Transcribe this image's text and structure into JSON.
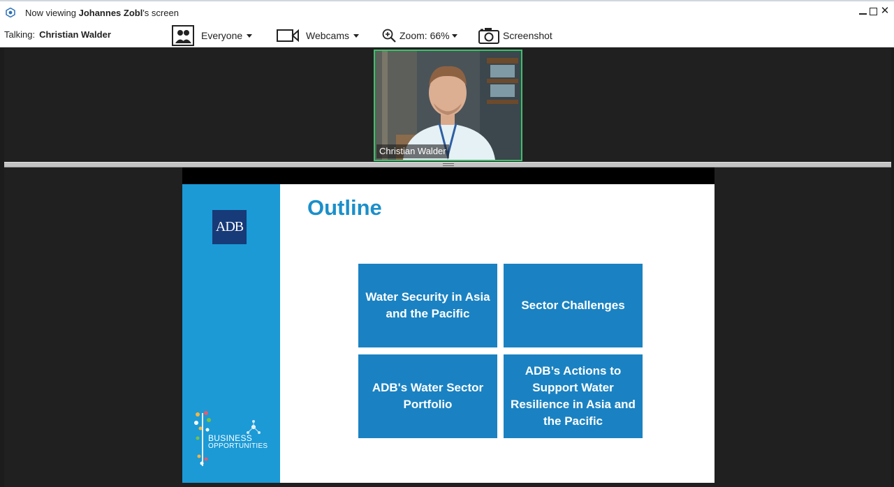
{
  "window": {
    "title_prefix": "Now viewing ",
    "presenter": "Johannes Zobl",
    "title_suffix": "'s screen"
  },
  "toolbar": {
    "talking_label": "Talking:",
    "talking_name": "Christian Walder",
    "audience_label": "Everyone",
    "webcams_label": "Webcams",
    "zoom_label": "Zoom: 66%",
    "screenshot_label": "Screenshot"
  },
  "webcam": {
    "participant_name": "Christian Walder",
    "border_color": "#3cc16a"
  },
  "slide": {
    "logo_text": "ADB",
    "title": "Outline",
    "brand_line1": "BUSINESS",
    "brand_line2": "OPPORTUNITIES",
    "boxes": [
      "Water Security in Asia and the Pacific",
      "Sector Challenges",
      "ADB's Water Sector Portfolio",
      "ADB’s Actions to Support Water Resilience in Asia and the Pacific"
    ],
    "colors": {
      "sidebar": "#1b9ad6",
      "title": "#1b8fca",
      "box": "#1a82c2",
      "logo": "#173a78"
    }
  }
}
